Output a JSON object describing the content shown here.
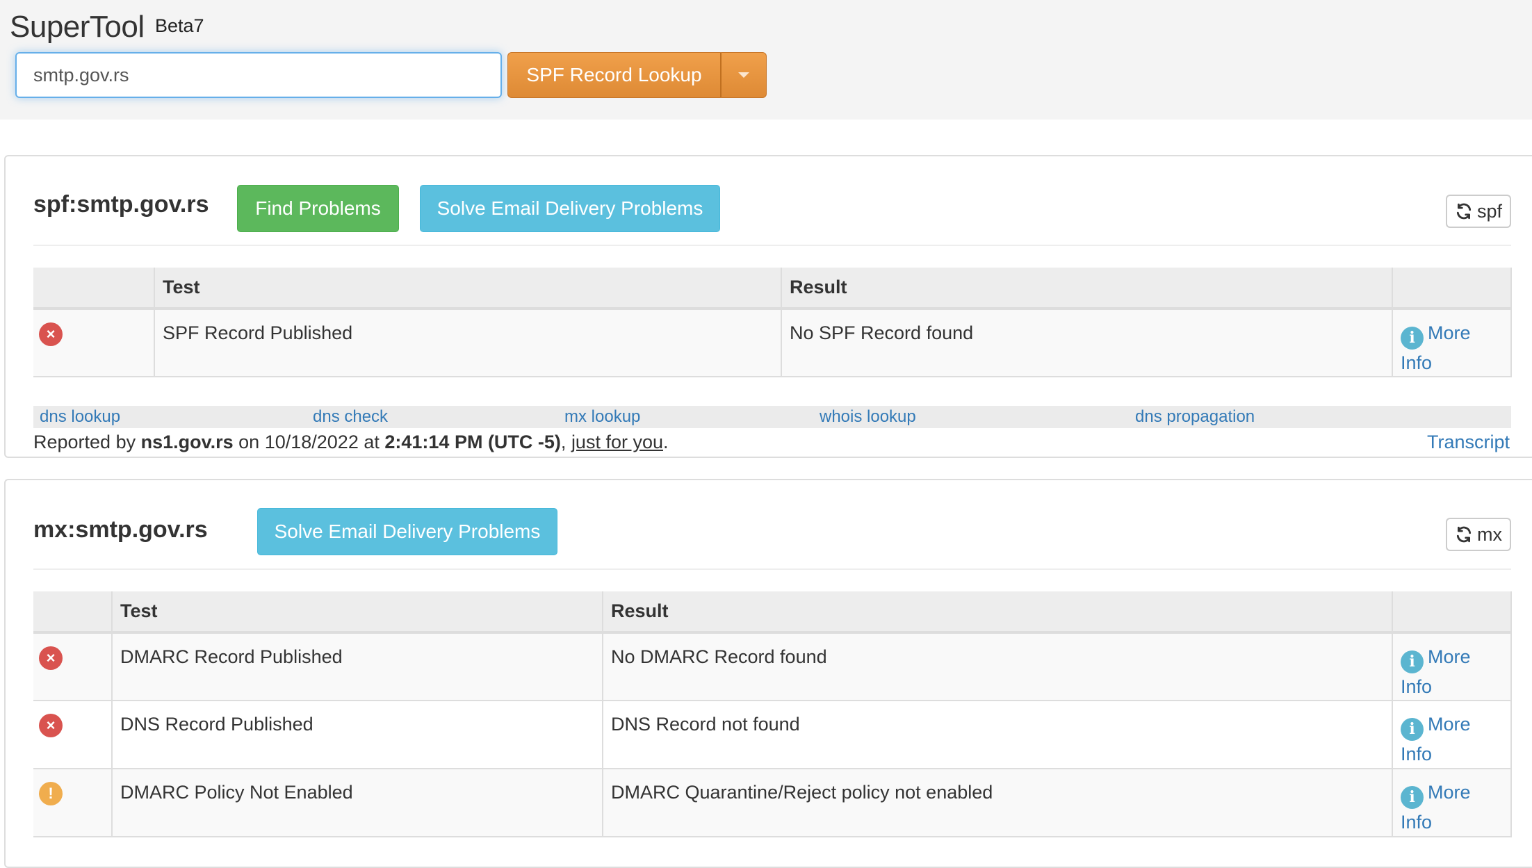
{
  "header": {
    "brand": "SuperTool",
    "brand_sup": "Beta7",
    "search_value": "smtp.gov.rs",
    "lookup_button": "SPF Record Lookup",
    "colors": {
      "accent_orange": "#e8923f",
      "input_focus": "#66afe9"
    }
  },
  "spf_panel": {
    "title": "spf:smtp.gov.rs",
    "find_problems": "Find Problems",
    "solve_problems": "Solve Email Delivery Problems",
    "refresh_label": "spf",
    "columns": [
      "",
      "Test",
      "Result",
      ""
    ],
    "rows": [
      {
        "status": "error",
        "test": "SPF Record Published",
        "result": "No SPF Record found",
        "more": "More",
        "info": "Info"
      }
    ],
    "links": [
      "dns lookup",
      "dns check",
      "mx lookup",
      "whois lookup",
      "dns propagation"
    ],
    "footer": {
      "reported_by_prefix": "Reported by ",
      "server": "ns1.gov.rs",
      "on": " on ",
      "date": "10/18/2022",
      "at": " at ",
      "time": "2:41:14 PM (UTC -5)",
      "comma": ", ",
      "just_for_you": "just for you",
      "period": ".",
      "transcript": "Transcript"
    }
  },
  "mx_panel": {
    "title": "mx:smtp.gov.rs",
    "solve_problems": "Solve Email Delivery Problems",
    "refresh_label": "mx",
    "columns": [
      "",
      "Test",
      "Result",
      ""
    ],
    "rows": [
      {
        "status": "error",
        "test": "DMARC Record Published",
        "result": "No DMARC Record found",
        "more": "More",
        "info": "Info"
      },
      {
        "status": "error",
        "test": "DNS Record Published",
        "result": "DNS Record not found",
        "more": "More",
        "info": "Info"
      },
      {
        "status": "warning",
        "test": "DMARC Policy Not Enabled",
        "result": "DMARC Quarantine/Reject policy not enabled",
        "more": "More",
        "info": "Info"
      }
    ]
  },
  "icons": {
    "error": "×",
    "warning": "!",
    "info": "i"
  }
}
